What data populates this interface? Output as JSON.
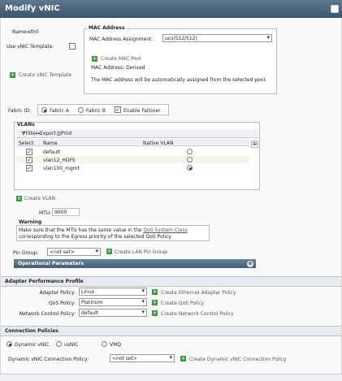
{
  "window": {
    "title": "Modify vNIC"
  },
  "name": {
    "label": "Name:",
    "value": "eth0"
  },
  "use_vnic_template": {
    "label": "Use vNIC Template:"
  },
  "create_vnic_template": "Create vNIC Template",
  "mac": {
    "group_title": "MAC Address",
    "assignment_label": "MAC Address Assignment:",
    "assignment_value": "ucs(512/512)",
    "create_pool": "Create MAC Pool",
    "address_line": "MAC Address: Derived",
    "note": "The MAC address will be automatically assigned from the selected pool."
  },
  "fabric": {
    "label": "Fabric ID:",
    "a": "Fabric A",
    "b": "Fabric B",
    "failover": "Enable Failover"
  },
  "vlans": {
    "title": "VLANs",
    "filter": "Filter",
    "export": "Export",
    "print": "Print",
    "columns": [
      "Select",
      "Name",
      "Native VLAN"
    ],
    "rows": [
      {
        "name": "default",
        "selected": true,
        "native": false
      },
      {
        "name": "vlan12_HDFS",
        "selected": true,
        "native": false
      },
      {
        "name": "vlan100_mgmt",
        "selected": true,
        "native": true
      }
    ]
  },
  "create_vlan": "Create VLAN",
  "mtu": {
    "label": "MTU:",
    "value": "9000"
  },
  "warning": {
    "title": "Warning",
    "text_a": "Make sure that the MTU has the same value in the",
    "link": "QoS System Class",
    "text_b": "corresponding to the Egress priority of the selected QoS Policy."
  },
  "pin_group": {
    "label": "Pin Group:",
    "value": "<not set>",
    "create": "Create LAN Pin Group"
  },
  "operational": "Operational Parameters",
  "adapter": {
    "title": "Adapter Performance Profile",
    "rows": [
      {
        "label": "Adapter Policy:",
        "value": "Linux",
        "create": "Create Ethernet Adapter Policy"
      },
      {
        "label": "QoS Policy:",
        "value": "Platinum",
        "create": "Create QoS Policy"
      },
      {
        "label": "Network Control Policy:",
        "value": "default",
        "create": "Create Network Control Policy"
      }
    ]
  },
  "connection": {
    "title": "Connection Policies",
    "options": [
      "Dynamic vNIC",
      "usNIC",
      "VMQ"
    ],
    "policy_label": "Dynamic vNIC Connection Policy:",
    "policy_value": "<not set>",
    "create": "Create Dynamic vNIC Connection Policy"
  }
}
